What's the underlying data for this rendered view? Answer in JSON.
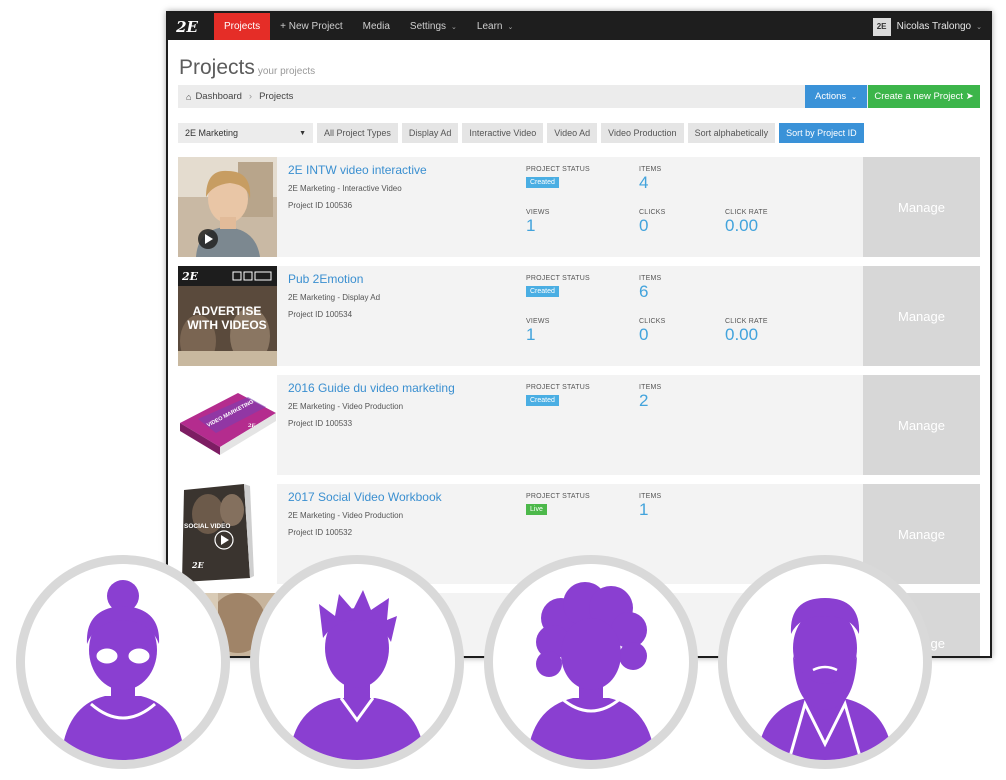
{
  "navbar": {
    "logo": "2E",
    "items": [
      {
        "label": "Projects",
        "active": true,
        "caret": false
      },
      {
        "label": "+ New Project",
        "active": false,
        "caret": false
      },
      {
        "label": "Media",
        "active": false,
        "caret": false
      },
      {
        "label": "Settings",
        "active": false,
        "caret": true
      },
      {
        "label": "Learn",
        "active": false,
        "caret": true
      }
    ],
    "user_name": "Nicolas Tralongo"
  },
  "header": {
    "title": "Projects",
    "subtitle": "your projects"
  },
  "breadcrumb": {
    "home": "Dashboard",
    "current": "Projects"
  },
  "toolbar": {
    "actions_label": "Actions",
    "create_label": "Create a new Project"
  },
  "filters": {
    "selected_company": "2E Marketing",
    "buttons": [
      "All Project Types",
      "Display Ad",
      "Interactive Video",
      "Video Ad",
      "Video Production",
      "Sort alphabetically",
      "Sort by Project ID"
    ],
    "active": "Sort by Project ID"
  },
  "labels": {
    "project_status": "PROJECT STATUS",
    "items": "ITEMS",
    "views": "VIEWS",
    "clicks": "CLICKS",
    "click_rate": "CLICK RATE",
    "manage": "Manage"
  },
  "projects": [
    {
      "name": "2E INTW video interactive",
      "subtitle": "2E Marketing - Interactive Video",
      "id_text": "Project ID 100536",
      "status": "Created",
      "items": "4",
      "views": "1",
      "clicks": "0",
      "click_rate": "0.00"
    },
    {
      "name": "Pub 2Emotion",
      "subtitle": "2E Marketing - Display Ad",
      "id_text": "Project ID 100534",
      "status": "Created",
      "items": "6",
      "views": "1",
      "clicks": "0",
      "click_rate": "0.00",
      "thumb_text_1": "ADVERTISE",
      "thumb_text_2": "WITH VIDEOS"
    },
    {
      "name": "2016 Guide du video marketing",
      "subtitle": "2E Marketing - Video Production",
      "id_text": "Project ID 100533",
      "status": "Created",
      "items": "2",
      "thumb_text_1": "VIDEO MARKETING"
    },
    {
      "name": "2017 Social Video Workbook",
      "subtitle": "2E Marketing - Video Production",
      "id_text": "Project ID 100532",
      "status": "Live",
      "items": "1",
      "thumb_text_1": "SOCIAL VIDEO"
    }
  ],
  "colors": {
    "accent_red": "#e52d27",
    "link_blue": "#3a8fd0",
    "action_blue": "#3a92d8",
    "create_green": "#3cb54a",
    "avatar_purple": "#8a3fd1"
  },
  "personas": [
    "grandmother-avatar-icon",
    "young-man-avatar-icon",
    "curly-hair-woman-avatar-icon",
    "bearded-man-avatar-icon"
  ]
}
